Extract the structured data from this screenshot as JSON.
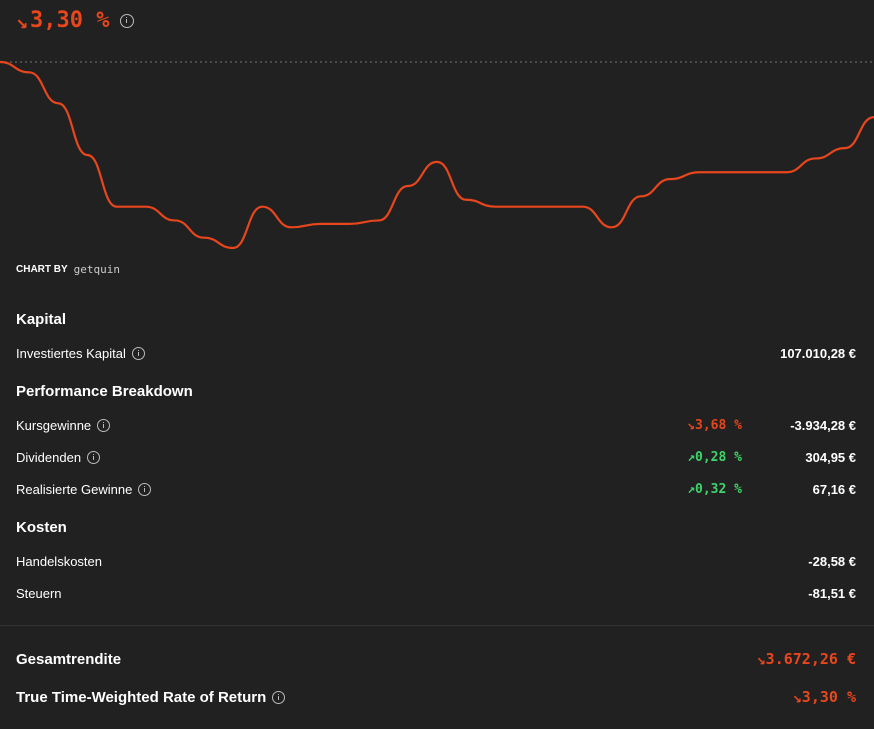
{
  "header": {
    "performance_arrow": "↘",
    "performance_value": "3,30 %"
  },
  "chart_data": {
    "type": "line",
    "title": "",
    "xlabel": "",
    "ylabel": "",
    "values": [
      4.2,
      3.9,
      3.0,
      1.5,
      0.0,
      0.0,
      -0.4,
      -0.9,
      -1.2,
      0.0,
      -0.6,
      -0.5,
      -0.5,
      -0.4,
      0.6,
      1.3,
      0.2,
      0.0,
      0.0,
      0.0,
      0.0,
      -0.6,
      0.3,
      0.8,
      1.0,
      1.0,
      1.0,
      1.0,
      1.4,
      1.7,
      2.6
    ],
    "baseline": 4.2,
    "color": "#e8461c"
  },
  "chart_credit": {
    "label": "CHART BY",
    "brand": "getquin"
  },
  "kapital": {
    "title": "Kapital",
    "invested_label": "Investiertes Kapital",
    "invested_value": "107.010,28 €"
  },
  "breakdown": {
    "title": "Performance Breakdown",
    "rows": [
      {
        "label": "Kursgewinne",
        "arrow": "↘",
        "pct": "3,68 %",
        "value": "-3.934,28 €"
      },
      {
        "label": "Dividenden",
        "arrow": "↗",
        "pct": "0,28 %",
        "value": "304,95 €"
      },
      {
        "label": "Realisierte Gewinne",
        "arrow": "↗",
        "pct": "0,32 %",
        "value": "67,16 €"
      }
    ]
  },
  "kosten": {
    "title": "Kosten",
    "rows": [
      {
        "label": "Handelskosten",
        "value": "-28,58 €"
      },
      {
        "label": "Steuern",
        "value": "-81,51 €"
      }
    ]
  },
  "totals": {
    "total_label": "Gesamtrendite",
    "total_value": "↘3.672,26 €",
    "ttwror_label": "True Time-Weighted Rate of Return",
    "ttwror_value": "↘3,30 %"
  },
  "colors": {
    "negative": "#e8461c",
    "positive": "#3fd46a",
    "background": "#212121"
  }
}
